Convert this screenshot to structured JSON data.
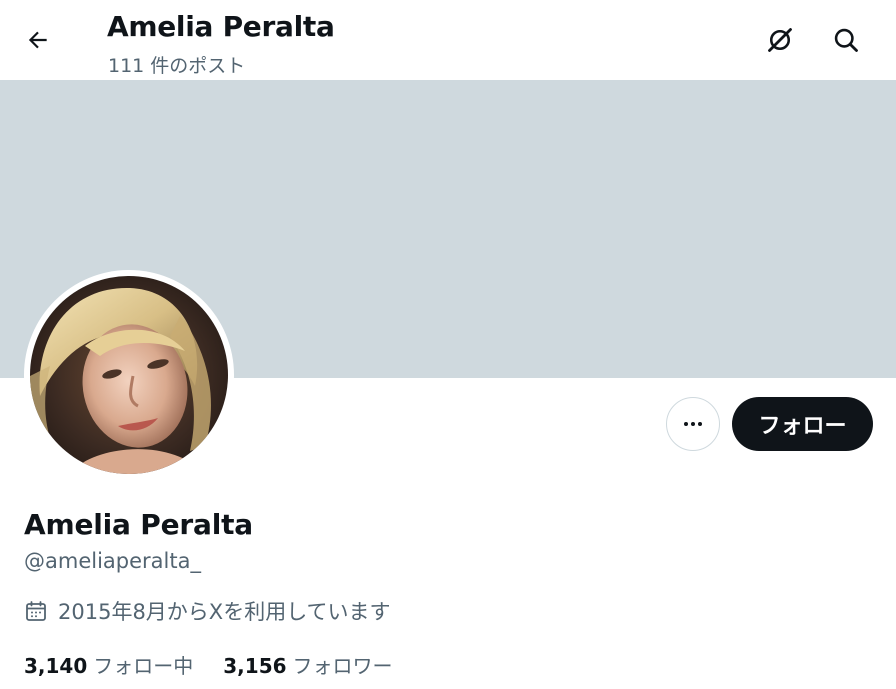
{
  "header": {
    "title": "Amelia Peralta",
    "post_count": "111 件のポスト",
    "back_icon": "arrow-left-icon",
    "grok_icon": "grok-slash-icon",
    "search_icon": "search-icon"
  },
  "profile": {
    "display_name": "Amelia Peralta",
    "handle": "@ameliaperalta_",
    "joined": "2015年8月からXを利用しています",
    "follow_label": "フォロー",
    "more_icon": "more-dots-icon",
    "calendar_icon": "calendar-icon",
    "banner_color": "#cfd9de",
    "stats": {
      "following_count": "3,140",
      "following_label": "フォロー中",
      "followers_count": "3,156",
      "followers_label": "フォロワー"
    }
  },
  "colors": {
    "text": "#0f1419",
    "secondary": "#536471",
    "button_bg": "#0f1419"
  }
}
